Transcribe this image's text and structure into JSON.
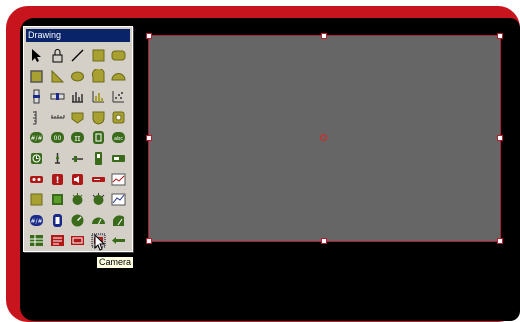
{
  "palette": {
    "title": "Drawing",
    "tools": [
      "pointer-icon",
      "lock-icon",
      "line-icon",
      "rectangle-icon",
      "rounded-rect-icon",
      "block-icon",
      "right-triangle-icon",
      "ellipse-icon",
      "quarter-shape-icon",
      "half-disc-icon",
      "vertical-slider-icon",
      "horizontal-slider-icon",
      "bar-chart-icon",
      "histogram-icon",
      "scatter-icon",
      "vertical-scale-icon",
      "horizontal-scale-icon",
      "pentagon-icon",
      "shield-icon",
      "gear-icon",
      "numeric-display-icon",
      "digital-display-icon",
      "pi-display-icon",
      "input-icon",
      "abc-display-icon",
      "clock-icon",
      "vertical-pointer-icon",
      "horizontal-pointer-icon",
      "vertical-indicator-icon",
      "horizontal-indicator-icon",
      "led-red-icon",
      "alarm-icon",
      "speaker-icon",
      "bar-display-icon",
      "trend-icon",
      "button-icon",
      "square-button-icon",
      "knob-icon",
      "rotary-switch-icon",
      "xy-plot-icon",
      "numeric-input-icon",
      "digital-input-icon",
      "gauge-icon",
      "dial-icon",
      "meter-icon",
      "table-icon",
      "list-icon",
      "text-box-icon",
      "camera-icon",
      "arrow-left-icon"
    ]
  },
  "tooltip": {
    "text": "Camera"
  },
  "colors": {
    "frame": "#c8141c",
    "canvas": "#666666",
    "title_bar": "#0a246a"
  }
}
